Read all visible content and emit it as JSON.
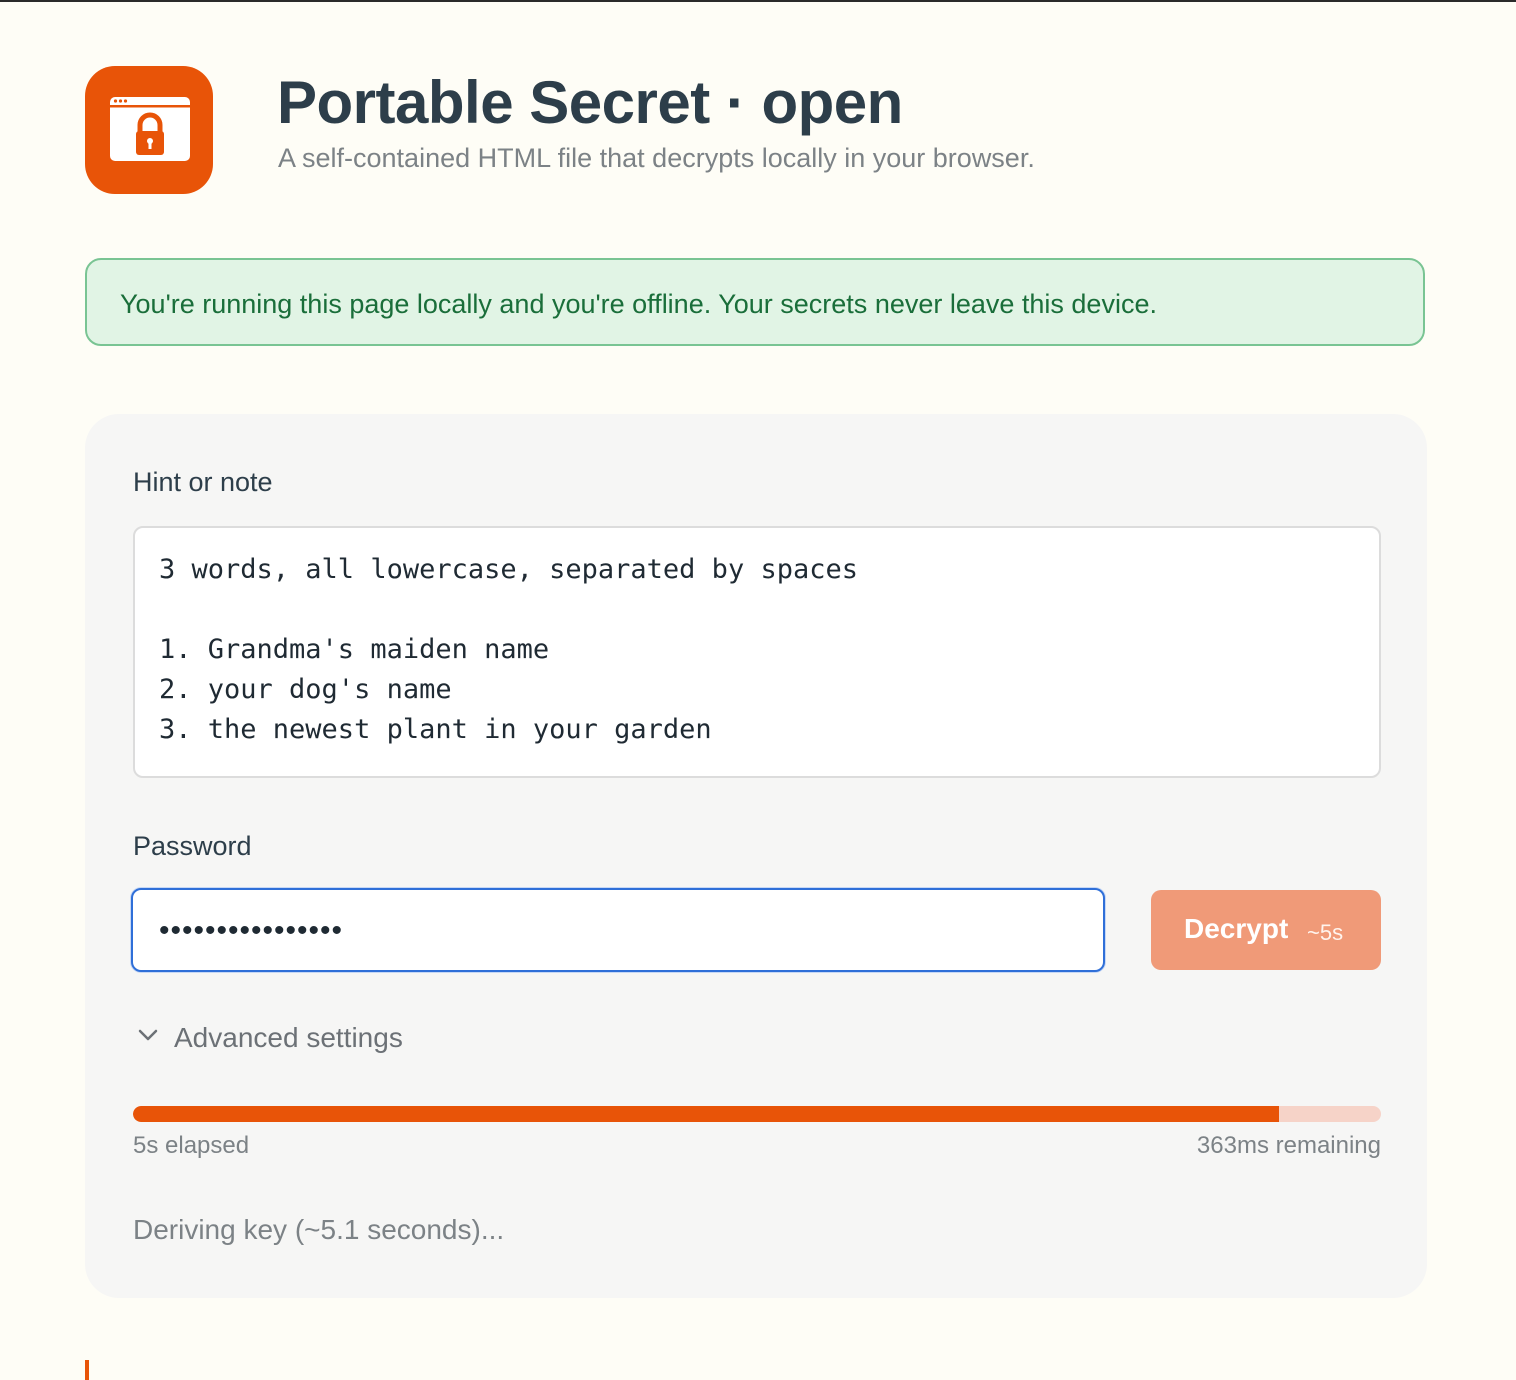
{
  "header": {
    "title": "Portable Secret · open",
    "subtitle": "A self-contained HTML file that decrypts locally in your browser.",
    "logo_icon": "browser-lock-icon"
  },
  "banner": {
    "message": "You're running this page locally and you're offline. Your secrets never leave this device."
  },
  "form": {
    "hint_label": "Hint or note",
    "hint_text": "3 words, all lowercase, separated by spaces\n\n1. Grandma's maiden name\n2. your dog's name\n3. the newest plant in your garden",
    "password_label": "Password",
    "password_value": "••••••••••••••••",
    "decrypt_label": "Decrypt",
    "decrypt_estimate": "~5s",
    "advanced_label": "Advanced settings"
  },
  "progress": {
    "fraction": 0.918,
    "elapsed": "5s elapsed",
    "remaining": "363ms remaining"
  },
  "status": {
    "message": "Deriving key (~5.1 seconds)..."
  },
  "colors": {
    "accent": "#e85408",
    "banner_bg": "#e1f4e5",
    "banner_text": "#1a6e3a",
    "focus_ring": "#2f6fd8"
  }
}
